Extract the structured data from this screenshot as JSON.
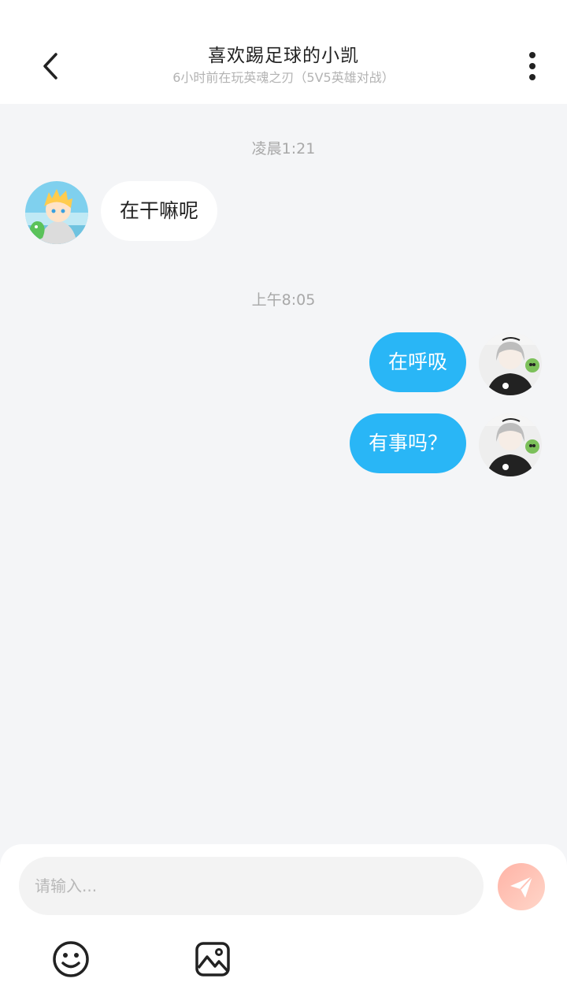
{
  "header": {
    "title": "喜欢踢足球的小凯",
    "subtitle": "6小时前在玩英魂之刃（5V5英雄对战）"
  },
  "messages": [
    {
      "type": "timestamp",
      "text": "凌晨1:21"
    },
    {
      "type": "incoming",
      "text": "在干嘛呢"
    },
    {
      "type": "timestamp",
      "text": "上午8:05"
    },
    {
      "type": "outgoing",
      "text": "在呼吸"
    },
    {
      "type": "outgoing",
      "text": "有事吗？"
    }
  ],
  "composer": {
    "placeholder": "请输入...",
    "send_icon": "send-icon",
    "emoji_icon": "emoji-icon",
    "image_icon": "image-icon"
  },
  "colors": {
    "outgoing_bubble": "#29b6f6",
    "incoming_bubble": "#ffffff",
    "background": "#f4f5f7",
    "send_button": "#ffc4b8"
  }
}
